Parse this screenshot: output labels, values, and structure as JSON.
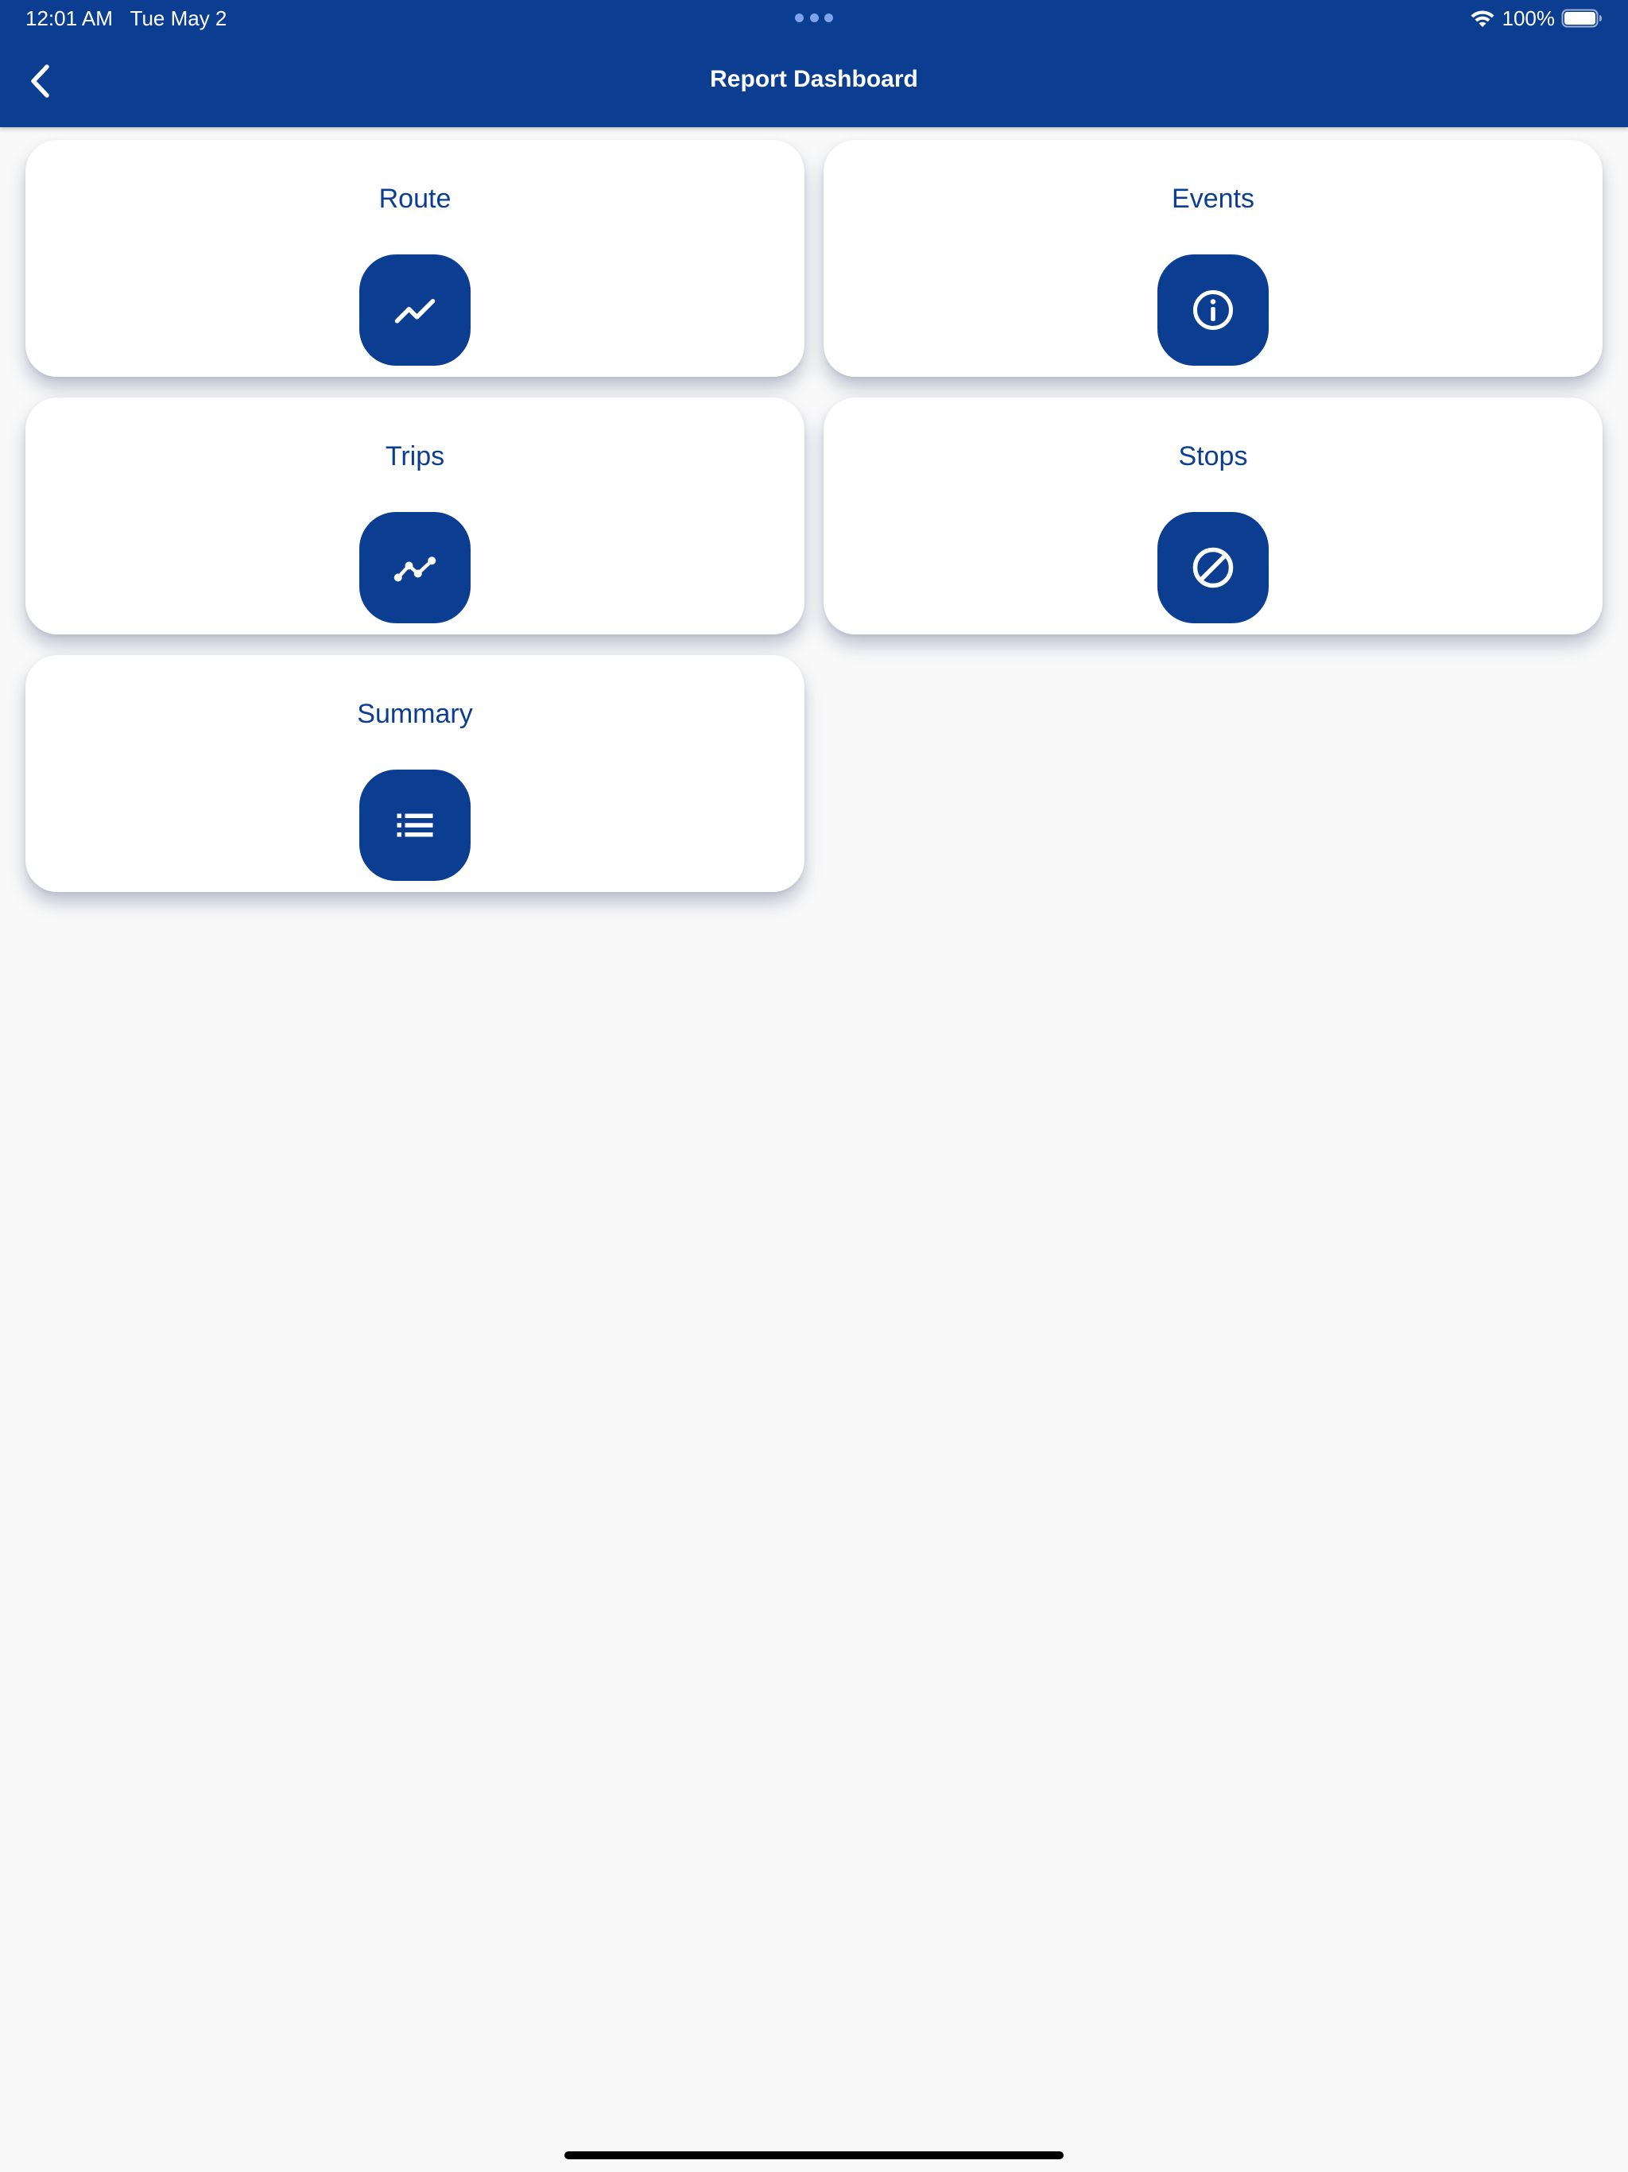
{
  "status_bar": {
    "time": "12:01 AM",
    "date": "Tue May 2",
    "battery": "100%"
  },
  "header": {
    "title": "Report Dashboard",
    "back_icon": "chevron-left-icon"
  },
  "colors": {
    "primary": "#0b3e91",
    "background": "#f9f9f9",
    "card": "#ffffff"
  },
  "reports": [
    {
      "label": "Route",
      "icon": "trending-up-icon"
    },
    {
      "label": "Events",
      "icon": "info-icon"
    },
    {
      "label": "Trips",
      "icon": "polyline-icon"
    },
    {
      "label": "Stops",
      "icon": "block-icon"
    },
    {
      "label": "Summary",
      "icon": "list-icon"
    }
  ]
}
